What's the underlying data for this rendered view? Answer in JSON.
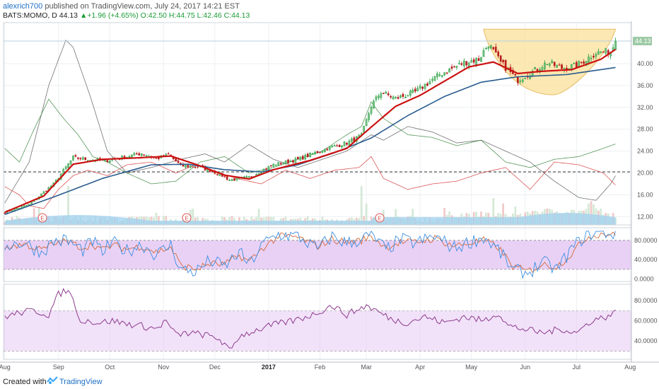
{
  "header": {
    "author": "alexrich700",
    "publish_text": "published on TradingView.com, July 24, 2017 14:21 EST",
    "symbol": "BATS:MOMO, D",
    "last": "44.13",
    "change": "+1.96 (+4.65%)",
    "ohlc": "O:42.50 H:44.75 L:42.46 C:44.13"
  },
  "footer": {
    "created_with": "Created with",
    "brand": "TradingView"
  },
  "chart_data": [
    {
      "type": "candlestick",
      "title": "BATS:MOMO, D",
      "y_ticks": [
        "12.00",
        "16.00",
        "20.00",
        "24.00",
        "28.00",
        "32.00",
        "36.00",
        "40.00"
      ],
      "ylim": [
        10.5,
        47.5
      ],
      "last_price_label": "44.13",
      "dashed_reference_level": 20.2,
      "x_labels": [
        "Aug",
        "Sep",
        "Oct",
        "Nov",
        "Dec",
        "2017",
        "Feb",
        "Mar",
        "Apr",
        "May",
        "Jun",
        "Jul",
        "Aug"
      ],
      "x_label_day_index": [
        0,
        22,
        43,
        65,
        86,
        108,
        129,
        148,
        170,
        191,
        213,
        234,
        256
      ],
      "close_anchors": [
        [
          0,
          12.8
        ],
        [
          10,
          14.2
        ],
        [
          20,
          18
        ],
        [
          28,
          22.8
        ],
        [
          40,
          22.2
        ],
        [
          48,
          22.8
        ],
        [
          56,
          23.6
        ],
        [
          62,
          22.6
        ],
        [
          67,
          23.4
        ],
        [
          72,
          21.3
        ],
        [
          80,
          21.1
        ],
        [
          88,
          19.8
        ],
        [
          92,
          18.7
        ],
        [
          100,
          19.2
        ],
        [
          110,
          21.5
        ],
        [
          120,
          22.5
        ],
        [
          132,
          24.5
        ],
        [
          140,
          25.5
        ],
        [
          146,
          26.8
        ],
        [
          150,
          32.3
        ],
        [
          154,
          34.8
        ],
        [
          160,
          33.6
        ],
        [
          168,
          34.8
        ],
        [
          178,
          38
        ],
        [
          188,
          40.2
        ],
        [
          194,
          40.8
        ],
        [
          198,
          43.6
        ],
        [
          203,
          40.2
        ],
        [
          210,
          37
        ],
        [
          216,
          38.5
        ],
        [
          222,
          40.2
        ],
        [
          228,
          39.2
        ],
        [
          234,
          39.6
        ],
        [
          242,
          42
        ],
        [
          248,
          42.2
        ],
        [
          250,
          44.13
        ]
      ],
      "ema_anchors": [
        [
          0,
          12.8
        ],
        [
          16,
          15.8
        ],
        [
          28,
          21.6
        ],
        [
          40,
          22.5
        ],
        [
          56,
          22.8
        ],
        [
          68,
          23.1
        ],
        [
          80,
          21.3
        ],
        [
          90,
          19.6
        ],
        [
          100,
          18.9
        ],
        [
          110,
          20.6
        ],
        [
          125,
          22.3
        ],
        [
          140,
          24.5
        ],
        [
          150,
          28.4
        ],
        [
          160,
          32.2
        ],
        [
          170,
          34.2
        ],
        [
          190,
          39.4
        ],
        [
          200,
          40.3
        ],
        [
          210,
          38.2
        ],
        [
          220,
          38.6
        ],
        [
          232,
          38.9
        ],
        [
          244,
          40.8
        ],
        [
          250,
          42.6
        ]
      ],
      "sma_anchors": [
        [
          0,
          12.4
        ],
        [
          20,
          15.6
        ],
        [
          40,
          19
        ],
        [
          60,
          21.5
        ],
        [
          75,
          21.6
        ],
        [
          90,
          20.6
        ],
        [
          105,
          20.2
        ],
        [
          120,
          21.5
        ],
        [
          135,
          23.7
        ],
        [
          150,
          26.4
        ],
        [
          165,
          30.5
        ],
        [
          180,
          34
        ],
        [
          195,
          36.6
        ],
        [
          210,
          37.6
        ],
        [
          230,
          38
        ],
        [
          250,
          39.3
        ]
      ],
      "overlay_gray_anchors": [
        [
          0,
          14.5
        ],
        [
          10,
          22
        ],
        [
          18,
          36
        ],
        [
          25,
          44.3
        ],
        [
          28,
          43
        ],
        [
          35,
          34
        ],
        [
          42,
          24
        ],
        [
          50,
          20
        ],
        [
          60,
          21
        ],
        [
          72,
          22.5
        ],
        [
          82,
          23.5
        ],
        [
          90,
          22
        ],
        [
          100,
          25.2
        ],
        [
          110,
          22.5
        ],
        [
          120,
          21
        ],
        [
          130,
          22.5
        ],
        [
          140,
          24
        ],
        [
          150,
          27
        ],
        [
          155,
          26
        ],
        [
          165,
          28.5
        ],
        [
          175,
          27.5
        ],
        [
          185,
          25.5
        ],
        [
          195,
          26
        ],
        [
          205,
          24
        ],
        [
          215,
          22
        ],
        [
          225,
          18.5
        ],
        [
          235,
          15.5
        ],
        [
          242,
          15
        ],
        [
          248,
          18
        ],
        [
          250,
          19.5
        ]
      ],
      "overlay_green_anchors": [
        [
          0,
          24.5
        ],
        [
          6,
          22
        ],
        [
          12,
          28
        ],
        [
          18,
          33.5
        ],
        [
          24,
          30
        ],
        [
          30,
          27
        ],
        [
          36,
          23
        ],
        [
          42,
          22
        ],
        [
          50,
          20
        ],
        [
          60,
          18
        ],
        [
          70,
          18.5
        ],
        [
          80,
          22
        ],
        [
          90,
          23
        ],
        [
          100,
          20
        ],
        [
          110,
          21
        ],
        [
          120,
          22.5
        ],
        [
          130,
          24
        ],
        [
          140,
          27
        ],
        [
          146,
          28.5
        ],
        [
          150,
          33
        ],
        [
          155,
          30
        ],
        [
          165,
          27
        ],
        [
          175,
          26.5
        ],
        [
          185,
          25
        ],
        [
          195,
          26
        ],
        [
          205,
          22
        ],
        [
          215,
          21
        ],
        [
          225,
          22.5
        ],
        [
          235,
          23
        ],
        [
          245,
          24.5
        ],
        [
          250,
          25.3
        ]
      ],
      "overlay_red_anchors": [
        [
          0,
          17.5
        ],
        [
          6,
          16
        ],
        [
          10,
          14
        ],
        [
          16,
          13.5
        ],
        [
          22,
          17
        ],
        [
          28,
          19.5
        ],
        [
          34,
          20.5
        ],
        [
          42,
          19.5
        ],
        [
          50,
          21.5
        ],
        [
          60,
          22
        ],
        [
          70,
          20
        ],
        [
          78,
          21.5
        ],
        [
          88,
          20
        ],
        [
          95,
          19
        ],
        [
          105,
          18
        ],
        [
          115,
          20.5
        ],
        [
          125,
          19
        ],
        [
          135,
          20.5
        ],
        [
          145,
          21
        ],
        [
          150,
          23
        ],
        [
          155,
          19
        ],
        [
          165,
          17
        ],
        [
          175,
          18
        ],
        [
          185,
          18.5
        ],
        [
          195,
          20
        ],
        [
          205,
          21
        ],
        [
          215,
          17
        ],
        [
          225,
          22
        ],
        [
          235,
          21.5
        ],
        [
          245,
          20
        ],
        [
          250,
          17.8
        ]
      ],
      "volume_bars": "relative volume histogram along the bottom of the price pane",
      "pattern_annotation": "cup shape (yellow) from mid-May to late July",
      "event_markers": [
        "E",
        "E",
        "E"
      ]
    },
    {
      "type": "line",
      "name": "Stochastic RSI",
      "y_ticks": [
        "0.0000",
        "40.0000",
        "80.0000"
      ],
      "ylim": [
        -5,
        106
      ],
      "bands": [
        20,
        80
      ],
      "k_anchors": [
        [
          0,
          70
        ],
        [
          8,
          75
        ],
        [
          15,
          55
        ],
        [
          20,
          78
        ],
        [
          25,
          80
        ],
        [
          32,
          60
        ],
        [
          36,
          78
        ],
        [
          40,
          55
        ],
        [
          44,
          76
        ],
        [
          50,
          58
        ],
        [
          56,
          72
        ],
        [
          62,
          50
        ],
        [
          68,
          70
        ],
        [
          72,
          20
        ],
        [
          78,
          15
        ],
        [
          84,
          38
        ],
        [
          90,
          26
        ],
        [
          96,
          55
        ],
        [
          100,
          30
        ],
        [
          106,
          74
        ],
        [
          112,
          92
        ],
        [
          120,
          88
        ],
        [
          128,
          62
        ],
        [
          134,
          88
        ],
        [
          140,
          74
        ],
        [
          146,
          82
        ],
        [
          150,
          92
        ],
        [
          156,
          60
        ],
        [
          162,
          82
        ],
        [
          168,
          74
        ],
        [
          176,
          88
        ],
        [
          184,
          64
        ],
        [
          190,
          76
        ],
        [
          196,
          86
        ],
        [
          202,
          60
        ],
        [
          208,
          18
        ],
        [
          214,
          12
        ],
        [
          220,
          35
        ],
        [
          226,
          20
        ],
        [
          232,
          62
        ],
        [
          238,
          92
        ],
        [
          244,
          97
        ],
        [
          250,
          93
        ]
      ],
      "d_anchors": [
        [
          0,
          65
        ],
        [
          8,
          72
        ],
        [
          15,
          60
        ],
        [
          20,
          72
        ],
        [
          25,
          78
        ],
        [
          32,
          65
        ],
        [
          36,
          72
        ],
        [
          40,
          60
        ],
        [
          44,
          70
        ],
        [
          50,
          62
        ],
        [
          56,
          68
        ],
        [
          62,
          56
        ],
        [
          68,
          66
        ],
        [
          72,
          28
        ],
        [
          78,
          20
        ],
        [
          84,
          32
        ],
        [
          90,
          30
        ],
        [
          96,
          48
        ],
        [
          100,
          36
        ],
        [
          106,
          66
        ],
        [
          112,
          88
        ],
        [
          120,
          86
        ],
        [
          128,
          68
        ],
        [
          134,
          82
        ],
        [
          140,
          76
        ],
        [
          146,
          80
        ],
        [
          150,
          88
        ],
        [
          156,
          66
        ],
        [
          162,
          76
        ],
        [
          168,
          76
        ],
        [
          176,
          84
        ],
        [
          184,
          68
        ],
        [
          190,
          74
        ],
        [
          196,
          80
        ],
        [
          202,
          66
        ],
        [
          208,
          26
        ],
        [
          214,
          16
        ],
        [
          220,
          30
        ],
        [
          226,
          26
        ],
        [
          232,
          52
        ],
        [
          238,
          86
        ],
        [
          244,
          94
        ],
        [
          250,
          92
        ]
      ]
    },
    {
      "type": "line",
      "name": "RSI",
      "y_ticks": [
        "40.0000",
        "60.0000",
        "80.0000"
      ],
      "ylim": [
        22,
        96
      ],
      "bands": [
        30,
        70
      ],
      "anchors": [
        [
          0,
          64
        ],
        [
          6,
          68
        ],
        [
          12,
          70
        ],
        [
          18,
          66
        ],
        [
          22,
          86
        ],
        [
          25,
          90
        ],
        [
          28,
          84
        ],
        [
          30,
          62
        ],
        [
          38,
          58
        ],
        [
          44,
          60
        ],
        [
          50,
          57
        ],
        [
          56,
          55
        ],
        [
          62,
          52
        ],
        [
          66,
          60
        ],
        [
          70,
          46
        ],
        [
          76,
          48
        ],
        [
          82,
          46
        ],
        [
          88,
          42
        ],
        [
          92,
          30
        ],
        [
          96,
          45
        ],
        [
          102,
          50
        ],
        [
          110,
          56
        ],
        [
          118,
          60
        ],
        [
          126,
          66
        ],
        [
          134,
          75
        ],
        [
          140,
          66
        ],
        [
          148,
          75
        ],
        [
          152,
          70
        ],
        [
          158,
          62
        ],
        [
          164,
          58
        ],
        [
          172,
          64
        ],
        [
          180,
          58
        ],
        [
          188,
          64
        ],
        [
          196,
          60
        ],
        [
          202,
          68
        ],
        [
          206,
          55
        ],
        [
          212,
          52
        ],
        [
          220,
          48
        ],
        [
          228,
          52
        ],
        [
          234,
          48
        ],
        [
          240,
          60
        ],
        [
          246,
          64
        ],
        [
          250,
          68
        ]
      ]
    }
  ],
  "colors": {
    "up": "#1b9b36",
    "down": "#b71c1c",
    "ema": "#cc1111",
    "sma": "#2a5d8f",
    "stoch_k": "#3d8fe0",
    "stoch_d": "#d46a3a",
    "rsi": "#8e3b8e",
    "band_fill": "#e4c6f4",
    "volume": "#9fd0ef",
    "cup_fill": "#fbe4a6",
    "cup_stroke": "#e2b24a"
  }
}
